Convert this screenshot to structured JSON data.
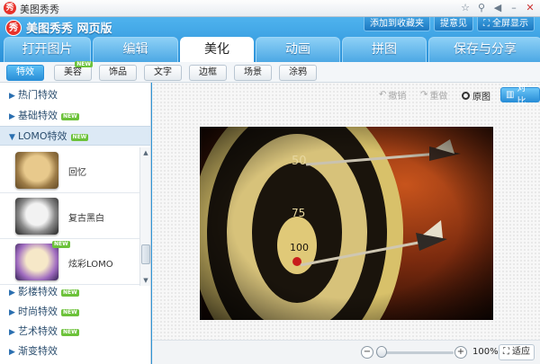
{
  "window": {
    "title": "美图秀秀"
  },
  "header": {
    "brand": "美图秀秀 网页版",
    "buttons": [
      {
        "label": "添加到收藏夹",
        "icon": "none"
      },
      {
        "label": "提意见",
        "icon": "none"
      },
      {
        "label": "全屏显示",
        "icon": "fullscreen-icon"
      }
    ]
  },
  "tabs": [
    "打开图片",
    "编辑",
    "美化",
    "动画",
    "拼图",
    "保存与分享"
  ],
  "active_tab": "美化",
  "subtabs": [
    {
      "label": "特效",
      "active": true,
      "new": false
    },
    {
      "label": "美容",
      "active": false,
      "new": true
    },
    {
      "label": "饰品",
      "active": false,
      "new": false
    },
    {
      "label": "文字",
      "active": false,
      "new": false
    },
    {
      "label": "边框",
      "active": false,
      "new": false
    },
    {
      "label": "场景",
      "active": false,
      "new": false
    },
    {
      "label": "涂鸦",
      "active": false,
      "new": false
    }
  ],
  "new_badge": "NEW",
  "sidebar": {
    "categories_top": [
      {
        "label": "热门特效",
        "new": false
      },
      {
        "label": "基础特效",
        "new": true
      },
      {
        "label": "LOMO特效",
        "new": true,
        "open": true
      }
    ],
    "effects": [
      {
        "label": "回忆",
        "new": false
      },
      {
        "label": "复古黑白",
        "new": false
      },
      {
        "label": "炫彩LOMO",
        "new": true
      }
    ],
    "categories_bottom": [
      {
        "label": "影楼特效",
        "new": true
      },
      {
        "label": "时尚特效",
        "new": true
      },
      {
        "label": "艺术特效",
        "new": true
      },
      {
        "label": "渐变特效",
        "new": false
      }
    ]
  },
  "canvas": {
    "undo": "撤销",
    "redo": "重做",
    "original": "原图",
    "compare": "对比"
  },
  "status": {
    "zoom": "100%",
    "fit": "适应"
  }
}
